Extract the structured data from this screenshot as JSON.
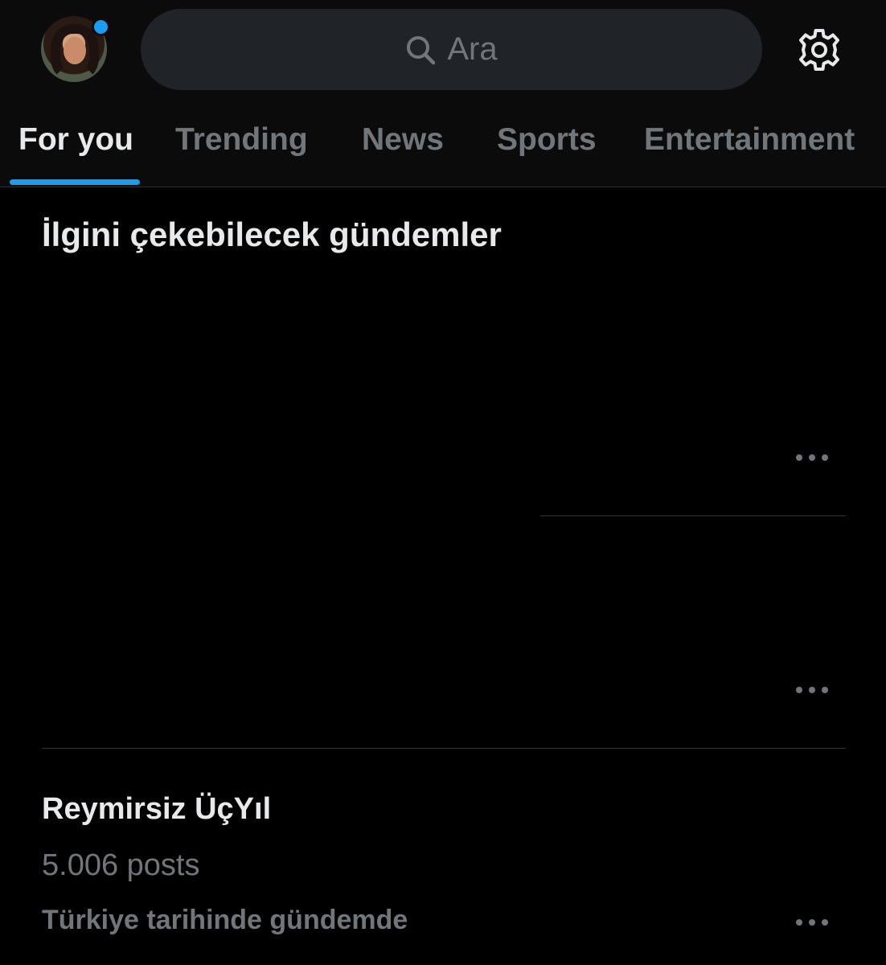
{
  "header": {
    "search_placeholder": "Ara"
  },
  "tabs": [
    {
      "label": "For you",
      "active": true
    },
    {
      "label": "Trending",
      "active": false
    },
    {
      "label": "News",
      "active": false
    },
    {
      "label": "Sports",
      "active": false
    },
    {
      "label": "Entertainment",
      "active": false
    }
  ],
  "section": {
    "title": "İlgini çekebilecek gündemler"
  },
  "trends": [
    {
      "name": "Reymirsiz ÜçYıl",
      "count": "5.006 posts",
      "context": "Türkiye tarihinde gündemde"
    }
  ],
  "colors": {
    "accent": "#1d9bf0",
    "background": "#000000",
    "header_bg": "#0b0b0b",
    "search_bg": "#202327",
    "text_primary": "#e7e9ea",
    "text_secondary": "#71767b",
    "divider": "#2f3336"
  },
  "icons": {
    "search": "search-icon",
    "settings": "gear-icon",
    "more": "more-options-icon"
  }
}
